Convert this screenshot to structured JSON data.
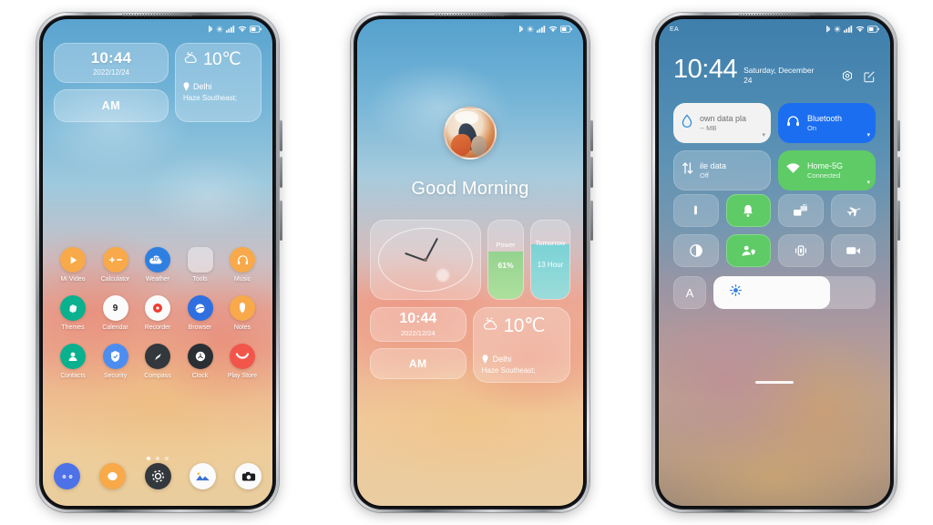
{
  "phones": [
    {
      "id": "home-screen",
      "status_bar": {
        "carrier": "",
        "icons": [
          "bluetooth-icon",
          "nfc-icon",
          "signal-icon",
          "wifi-icon",
          "battery-icon"
        ]
      },
      "widgets": {
        "clock": {
          "time": "10:44",
          "date": "2022/12/24"
        },
        "ampm": {
          "label": "AM"
        },
        "weather": {
          "temperature": "10℃",
          "city": "Delhi",
          "condition": "Haze Southeast;",
          "icon": "cloud-sun-icon"
        }
      },
      "apps": [
        [
          {
            "label": "Mi Video",
            "icon": "play-icon",
            "bg": "#f8a949",
            "shape": "circle"
          },
          {
            "label": "Calculator",
            "icon": "calculator-icon",
            "bg": "#f8a949",
            "shape": "circle"
          },
          {
            "label": "Weather",
            "icon": "weather-10-icon",
            "bg": "#2f7fe0",
            "shape": "circle"
          },
          {
            "label": "Tools",
            "icon": "folder-icon",
            "bg": "rgba(255,255,255,.38)",
            "shape": "square"
          },
          {
            "label": "Music",
            "icon": "headphone-icon",
            "bg": "#f8a949",
            "shape": "circle"
          }
        ],
        [
          {
            "label": "Themes",
            "icon": "themes-icon",
            "bg": "#0ab18e",
            "shape": "circle"
          },
          {
            "label": "Calendar",
            "icon": "calendar-9-icon",
            "bg": "#fbfbfb",
            "shape": "circle"
          },
          {
            "label": "Recorder",
            "icon": "record-icon",
            "bg": "#fbfbfb",
            "shape": "circle"
          },
          {
            "label": "Browser",
            "icon": "browser-icon",
            "bg": "#2f6fe0",
            "shape": "circle"
          },
          {
            "label": "Notes",
            "icon": "notes-icon",
            "bg": "#f8a949",
            "shape": "circle"
          }
        ],
        [
          {
            "label": "Contacts",
            "icon": "contact-icon",
            "bg": "#0ab18e",
            "shape": "circle"
          },
          {
            "label": "Security",
            "icon": "shield-icon",
            "bg": "#4d8df0",
            "shape": "circle"
          },
          {
            "label": "Compass",
            "icon": "compass-icon",
            "bg": "#33383d",
            "shape": "circle"
          },
          {
            "label": "Clock",
            "icon": "clock-icon",
            "bg": "#2a2f34",
            "shape": "circle"
          },
          {
            "label": "Play Store",
            "icon": "smile-icon",
            "bg": "#f2564b",
            "shape": "circle"
          }
        ]
      ],
      "page_dots": {
        "count": 3,
        "active": 0
      },
      "dock": [
        {
          "label": "Phone",
          "icon": "phone-icon",
          "bg": "#4d72e8"
        },
        {
          "label": "Messages",
          "icon": "message-icon",
          "bg": "#f8a949"
        },
        {
          "label": "Settings",
          "icon": "gear-icon",
          "bg": "#33383d"
        },
        {
          "label": "Gallery",
          "icon": "gallery-icon",
          "bg": "#fbfbfb"
        },
        {
          "label": "Camera",
          "icon": "camera-icon",
          "bg": "#fbfbfb"
        }
      ]
    },
    {
      "id": "lock-screen",
      "status_bar": {
        "carrier": "",
        "icons": [
          "bluetooth-icon",
          "nfc-icon",
          "signal-icon",
          "wifi-icon",
          "battery-icon"
        ]
      },
      "greeting": "Good Morning",
      "avatar": "user-avatar",
      "widgets": {
        "analog_clock": {
          "icon": "analog-clock-face"
        },
        "power": {
          "label": "Power",
          "value": "61%",
          "percent": 61
        },
        "tomorrow": {
          "label": "Tomorrow",
          "value": "13 Hour",
          "percent": 70
        },
        "clock": {
          "time": "10:44",
          "date": "2022/12/24"
        },
        "ampm": {
          "label": "AM"
        },
        "weather": {
          "temperature": "10℃",
          "city": "Delhi",
          "condition": "Haze Southeast;",
          "icon": "cloud-sun-icon"
        }
      }
    },
    {
      "id": "control-center",
      "status_bar": {
        "carrier": "EA",
        "icons": [
          "bluetooth-icon",
          "nfc-icon",
          "signal-icon",
          "wifi-icon",
          "battery-icon"
        ]
      },
      "header": {
        "time": "10:44",
        "date": "Saturday, December 24",
        "actions": [
          {
            "name": "settings-icon"
          },
          {
            "name": "edit-icon"
          }
        ]
      },
      "big_tiles": [
        {
          "title": "own data pla",
          "subtitle": "-- MB",
          "icon": "data-drop-icon",
          "state": "off",
          "style": "tile-data",
          "caret": "▾"
        },
        {
          "title": "Bluetooth",
          "subtitle": "On",
          "icon": "headphone-icon",
          "state": "on",
          "style": "tile-bt",
          "caret": "▾"
        },
        {
          "title": "ile data",
          "subtitle": "Off",
          "icon": "updown-icon",
          "state": "off",
          "style": "tile-mob",
          "caret": ""
        },
        {
          "title": "Home-5G",
          "subtitle": "Connected",
          "icon": "wifi-fill-icon",
          "state": "on",
          "style": "tile-wifi",
          "caret": "▾"
        }
      ],
      "quick_tiles": [
        {
          "name": "flashlight-icon",
          "state": "off"
        },
        {
          "name": "bell-icon",
          "state": "on"
        },
        {
          "name": "cast-icon",
          "state": "off"
        },
        {
          "name": "airplane-icon",
          "state": "off"
        },
        {
          "name": "contrast-icon",
          "state": "off"
        },
        {
          "name": "location-icon",
          "state": "on"
        },
        {
          "name": "vibrate-icon",
          "state": "off"
        },
        {
          "name": "screenrec-icon",
          "state": "off"
        }
      ],
      "brightness": {
        "auto_label": "A",
        "value": 72,
        "icon": "brightness-icon"
      }
    }
  ],
  "colors": {
    "accent_blue": "#1c6ef0",
    "accent_green": "#5ecb66",
    "accent_orange": "#f8a949",
    "tile_white": "#f2f2f2"
  }
}
